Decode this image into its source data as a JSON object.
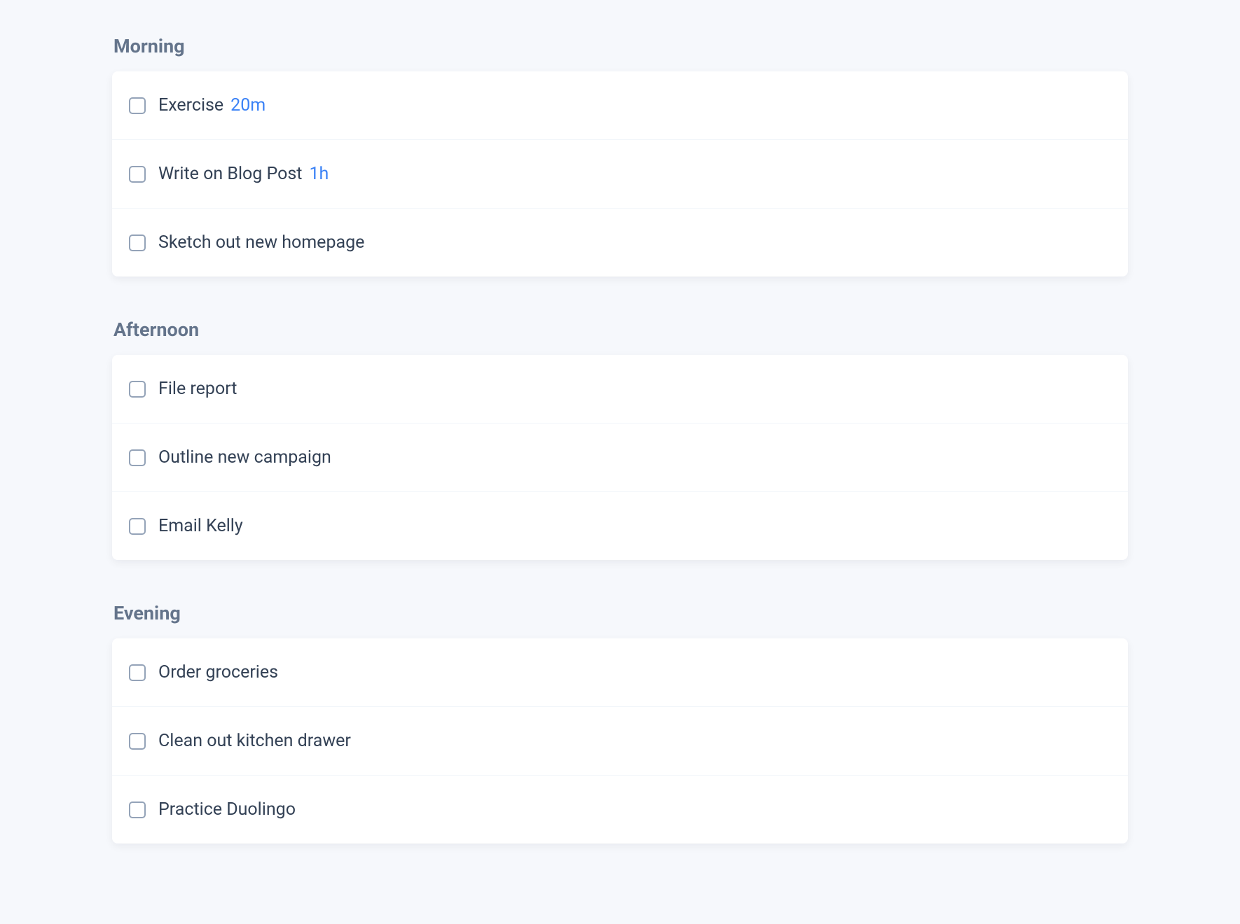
{
  "sections": [
    {
      "heading": "Morning",
      "tasks": [
        {
          "label": "Exercise",
          "duration": "20m"
        },
        {
          "label": "Write on Blog Post",
          "duration": "1h"
        },
        {
          "label": "Sketch out new homepage",
          "duration": ""
        }
      ]
    },
    {
      "heading": "Afternoon",
      "tasks": [
        {
          "label": "File report",
          "duration": ""
        },
        {
          "label": "Outline new campaign",
          "duration": ""
        },
        {
          "label": "Email Kelly",
          "duration": ""
        }
      ]
    },
    {
      "heading": "Evening",
      "tasks": [
        {
          "label": "Order groceries",
          "duration": ""
        },
        {
          "label": "Clean out kitchen drawer",
          "duration": ""
        },
        {
          "label": "Practice Duolingo",
          "duration": ""
        }
      ]
    }
  ]
}
